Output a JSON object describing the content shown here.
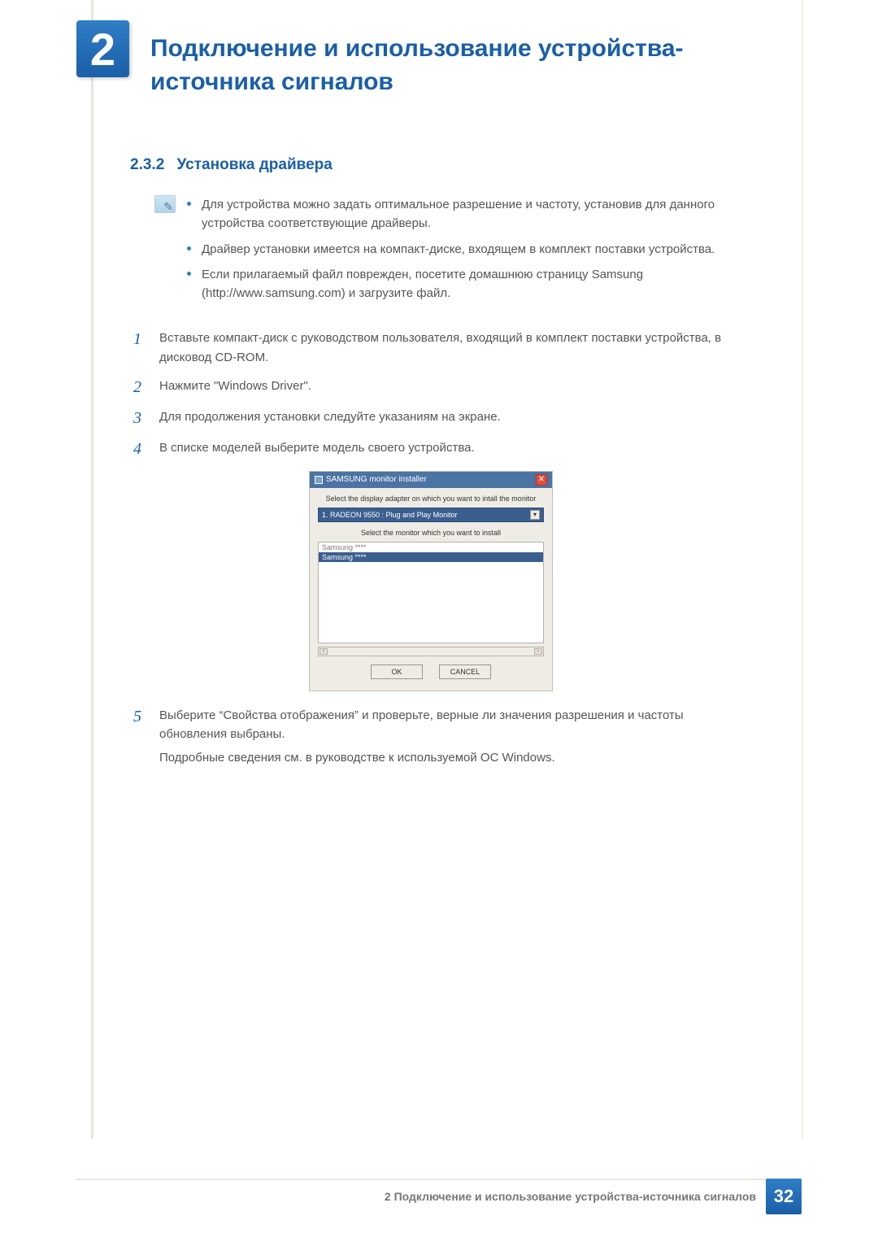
{
  "chapter": {
    "number": "2",
    "title": "Подключение и использование устройства-источника сигналов"
  },
  "section": {
    "number": "2.3.2",
    "title": "Установка драйвера"
  },
  "notes": [
    "Для устройства можно задать оптимальное разрешение и частоту, установив для данного устройства соответствующие драйверы.",
    "Драйвер установки имеется на компакт-диске, входящем в комплект поставки устройства.",
    "Если прилагаемый файл поврежден, посетите домашнюю страницу Samsung (http://www.samsung.com) и загрузите файл."
  ],
  "steps": [
    {
      "n": "1",
      "text": "Вставьте компакт-диск с руководством пользователя, входящий в комплект поставки устройства, в дисковод CD-ROM."
    },
    {
      "n": "2",
      "text": "Нажмите \"Windows Driver\"."
    },
    {
      "n": "3",
      "text": "Для продолжения установки следуйте указаниям на экране."
    },
    {
      "n": "4",
      "text": "В списке моделей выберите модель своего устройства."
    }
  ],
  "step5": {
    "n": "5",
    "line1": "Выберите “Свойства отображения” и проверьте, верные ли значения разрешения и частоты обновления выбраны.",
    "line2": "Подробные сведения см. в руководстве к используемой ОС Windows."
  },
  "installer": {
    "title": "SAMSUNG monitor installer",
    "label1": "Select the display adapter on which you want to intall the monitor",
    "combo": "1. RADEON 9550 : Plug and Play Monitor",
    "label2": "Select the monitor which you want to install",
    "options": [
      "Samsung ****",
      "Samsung ****"
    ],
    "ok": "OK",
    "cancel": "CANCEL"
  },
  "footer": {
    "text": "2 Подключение и использование устройства-источника сигналов",
    "page": "32"
  }
}
